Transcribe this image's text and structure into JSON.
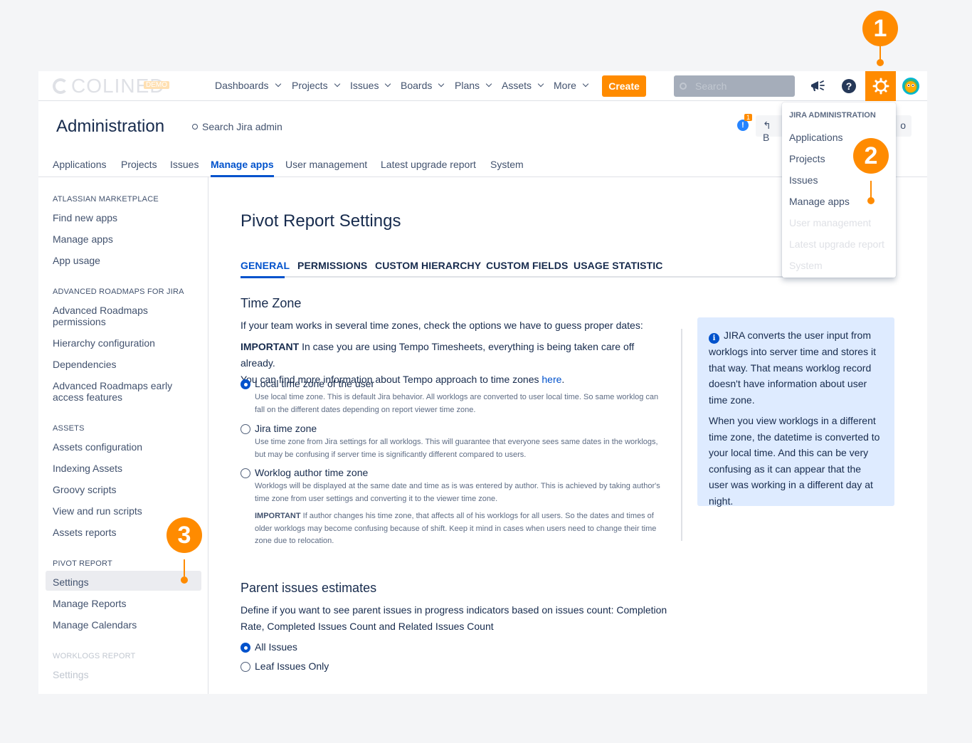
{
  "logo": {
    "text": "COLINED",
    "badge": "DEMO"
  },
  "nav": {
    "items": [
      "Dashboards",
      "Projects",
      "Issues",
      "Boards",
      "Plans",
      "Assets",
      "More"
    ],
    "create": "Create",
    "search_placeholder": "Search",
    "icons": [
      "megaphone-icon",
      "help-icon",
      "gear-icon",
      "avatar"
    ]
  },
  "admin": {
    "title": "Administration",
    "search": "Search Jira admin",
    "notification_count": "1",
    "back_label": "B",
    "right_label": "o",
    "tabs": [
      "Applications",
      "Projects",
      "Issues",
      "Manage apps",
      "User management",
      "Latest upgrade report",
      "System"
    ],
    "active_tab": "Manage apps"
  },
  "sidebar": {
    "sections": [
      {
        "title": "ATLASSIAN MARKETPLACE",
        "items": [
          "Find new apps",
          "Manage apps",
          "App usage"
        ]
      },
      {
        "title": "ADVANCED ROADMAPS FOR JIRA",
        "items": [
          "Advanced Roadmaps permissions",
          "Hierarchy configuration",
          "Dependencies",
          "Advanced Roadmaps early access features"
        ]
      },
      {
        "title": "ASSETS",
        "items": [
          "Assets configuration",
          "Indexing Assets",
          "Groovy scripts",
          "View and run scripts",
          "Assets reports"
        ]
      },
      {
        "title": "PIVOT REPORT",
        "items": [
          "Settings",
          "Manage Reports",
          "Manage Calendars"
        ]
      },
      {
        "title": "WORKLOGS REPORT",
        "items": [
          "Settings"
        ]
      }
    ],
    "selected": "Settings"
  },
  "main": {
    "title": "Pivot Report Settings",
    "tabs": [
      "GENERAL",
      "PERMISSIONS",
      "CUSTOM HIERARCHY",
      "CUSTOM FIELDS",
      "USAGE STATISTIC"
    ],
    "active_tab": "GENERAL",
    "timezone": {
      "title": "Time Zone",
      "intro": "If your team works in several time zones, check the options we have to guess proper dates:",
      "important_label": "IMPORTANT",
      "important_text": " In case you are using Tempo Timesheets, everything is being taken care off already.",
      "more_text": "You can find more information about Tempo approach to time zones ",
      "more_link": "here",
      "more_end": ".",
      "options": [
        {
          "label": "Local time zone of the user",
          "desc": "Use local time zone. This is default Jira behavior. All worklogs are converted to user local time. So same worklog can fall on the different dates depending on report viewer time zone.",
          "selected": true
        },
        {
          "label": "Jira time zone",
          "desc": "Use time zone from Jira settings for all worklogs. This will guarantee that everyone sees same dates in the worklogs, but may be confusing if server time is significantly different compared to users.",
          "selected": false
        },
        {
          "label": "Worklog author time zone",
          "desc": "Worklogs will be displayed at the same date and time as is was entered by author. This is achieved by taking author's time zone from user settings and converting it to the viewer time zone.",
          "selected": false
        }
      ],
      "option3_important_label": "IMPORTANT",
      "option3_important_text": " If author changes his time zone, that affects all of his worklogs for all users. So the dates and times of older worklogs may become confusing because of shift. Keep it mind in cases when users need to change their time zone due to relocation."
    },
    "info": {
      "p1": "JIRA converts the user input from worklogs into server time and stores it that way. That means worklog record doesn't have information about user time zone.",
      "p2": "When you view worklogs in a different time zone, the datetime is converted to your local time. And this can be very confusing as it can appear that the user was working in a different day at night."
    },
    "parent": {
      "title": "Parent issues estimates",
      "desc": "Define if you want to see parent issues in progress indicators based on issues count: Completion Rate, Completed Issues Count and Related Issues Count",
      "options": [
        {
          "label": "All Issues",
          "selected": true
        },
        {
          "label": "Leaf Issues Only",
          "selected": false
        }
      ]
    }
  },
  "dropdown": {
    "header": "JIRA ADMINISTRATION",
    "items": [
      "Applications",
      "Projects",
      "Issues",
      "Manage apps",
      "User management",
      "Latest upgrade report",
      "System"
    ]
  },
  "callouts": [
    "1",
    "2",
    "3"
  ],
  "colors": {
    "accent": "#ff8b00",
    "link": "#0052cc",
    "info_bg": "#deebff"
  }
}
